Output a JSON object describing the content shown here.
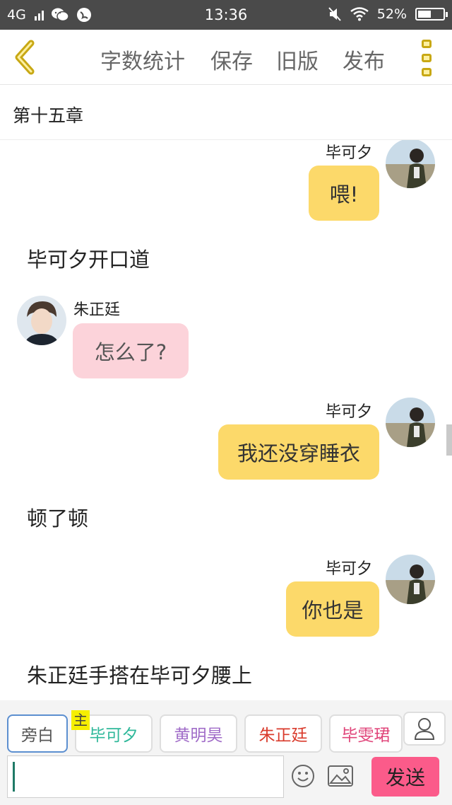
{
  "status_bar": {
    "network": "4G",
    "time": "13:36",
    "battery": "52%",
    "battery_level": 0.52
  },
  "toolbar": {
    "word_count": "字数统计",
    "save": "保存",
    "old_version": "旧版",
    "publish": "发布"
  },
  "chapter": {
    "title": "第十五章"
  },
  "messages": [
    {
      "speaker": "毕可夕",
      "text": "喂!"
    },
    {
      "narration": "毕可夕开口道"
    },
    {
      "speaker": "朱正廷",
      "text": "怎么了?"
    },
    {
      "speaker": "毕可夕",
      "text": "我还没穿睡衣"
    },
    {
      "narration": "顿了顿"
    },
    {
      "speaker": "毕可夕",
      "text": "你也是"
    },
    {
      "narration": "朱正廷手搭在毕可夕腰上"
    }
  ],
  "characters": {
    "narrator": "旁白",
    "main_badge": "主",
    "list": [
      {
        "name": "毕可夕",
        "color": "#2fb89a"
      },
      {
        "name": "黄明昊",
        "color": "#a06cc8"
      },
      {
        "name": "朱正廷",
        "color": "#d93a2b"
      },
      {
        "name": "毕雯珺",
        "color": "#e0457a"
      }
    ]
  },
  "input": {
    "value": "",
    "send_label": "发送"
  },
  "colors": {
    "self_bubble": "#fcd96a",
    "other_bubble": "#fcd3da",
    "send": "#fb5b8a",
    "accent": "#c8a814"
  }
}
